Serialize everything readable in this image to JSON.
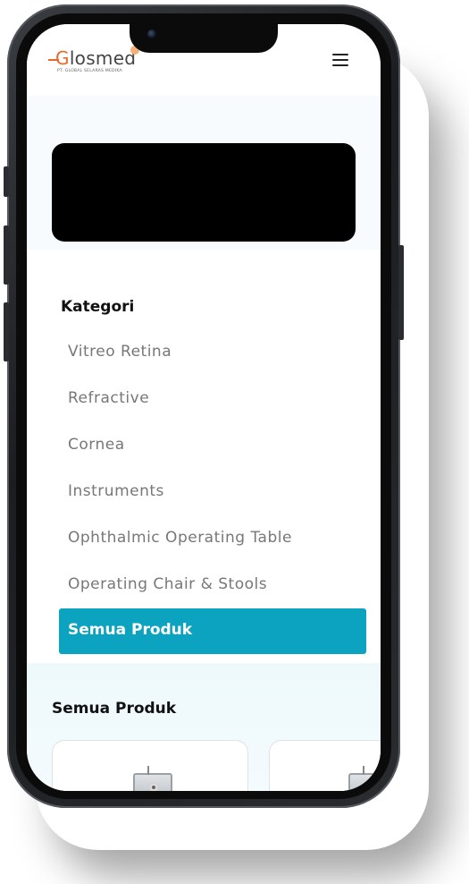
{
  "brand": {
    "name": "Glosmed",
    "tagline": "PT. GLOBAL SELARAS MEDIKA",
    "accent_color": "#e86a2a"
  },
  "header": {
    "menu_icon": "hamburger-menu-icon"
  },
  "categories": {
    "title": "Kategori",
    "items": [
      {
        "label": "Vitreo Retina"
      },
      {
        "label": "Refractive"
      },
      {
        "label": "Cornea"
      },
      {
        "label": "Instruments"
      },
      {
        "label": "Ophthalmic Operating Table"
      },
      {
        "label": "Operating Chair & Stools"
      }
    ],
    "active_label": "Semua Produk",
    "active_color": "#0ba3c0"
  },
  "products": {
    "title": "Semua Produk"
  }
}
